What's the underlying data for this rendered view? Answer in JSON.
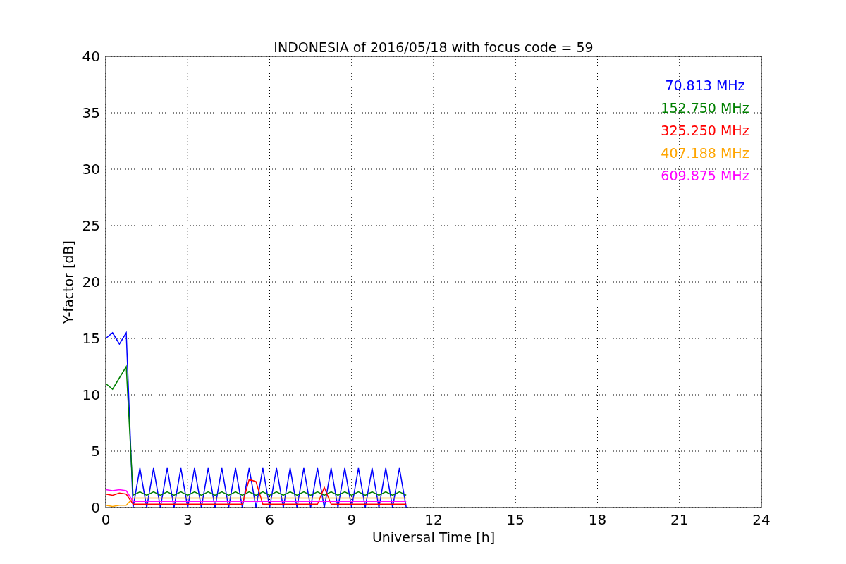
{
  "chart_data": {
    "type": "line",
    "title": "INDONESIA of 2016/05/18 with focus code = 59",
    "xlabel": "Universal Time [h]",
    "ylabel": "Y-factor [dB]",
    "x": [
      0,
      0.25,
      0.5,
      0.75,
      1,
      1.25,
      1.5,
      1.75,
      2,
      2.25,
      2.5,
      2.75,
      3,
      3.25,
      3.5,
      3.75,
      4,
      4.25,
      4.5,
      4.75,
      5,
      5.25,
      5.5,
      5.75,
      6,
      6.25,
      6.5,
      6.75,
      7,
      7.25,
      7.5,
      7.75,
      8,
      8.25,
      8.5,
      8.75,
      9,
      9.25,
      9.5,
      9.75,
      10,
      10.25,
      10.5,
      10.75,
      11
    ],
    "series": [
      {
        "name": "70.813 MHz",
        "color": "#0000ff",
        "values": [
          15,
          15.5,
          14.5,
          15.5,
          0,
          3.5,
          0,
          3.5,
          0,
          3.5,
          0,
          3.5,
          0,
          3.5,
          0,
          3.5,
          0,
          3.5,
          0,
          3.5,
          0,
          3.5,
          0,
          3.5,
          0,
          3.5,
          0,
          3.5,
          0,
          3.5,
          0,
          3.5,
          0,
          3.5,
          0,
          3.5,
          0,
          3.5,
          0,
          3.5,
          0,
          3.5,
          0,
          3.5,
          0
        ]
      },
      {
        "name": "152.750 MHz",
        "color": "#008000",
        "values": [
          11,
          10.5,
          11.5,
          12.5,
          1.1,
          1.4,
          1.1,
          1.4,
          1.1,
          1.4,
          1.1,
          1.4,
          1.1,
          1.4,
          1.1,
          1.4,
          1.1,
          1.4,
          1.1,
          1.4,
          1.1,
          1.4,
          1.1,
          1.4,
          1.1,
          1.4,
          1.1,
          1.4,
          1.1,
          1.4,
          1.1,
          1.4,
          1.1,
          1.4,
          1.1,
          1.4,
          1.1,
          1.4,
          1.1,
          1.4,
          1.1,
          1.4,
          1.1,
          1.4,
          1.1
        ]
      },
      {
        "name": "325.250 MHz",
        "color": "#ff0000",
        "values": [
          1.2,
          1.1,
          1.3,
          1.2,
          0.3,
          0.3,
          0.3,
          0.3,
          0.3,
          0.3,
          0.3,
          0.3,
          0.3,
          0.3,
          0.3,
          0.3,
          0.3,
          0.3,
          0.3,
          0.3,
          0.3,
          2.5,
          2.3,
          0.3,
          0.3,
          0.3,
          0.3,
          0.3,
          0.3,
          0.3,
          0.3,
          0.3,
          1.8,
          0.3,
          0.3,
          0.3,
          0.3,
          0.3,
          0.3,
          0.3,
          0.3,
          0.3,
          0.3,
          0.3,
          0.3
        ]
      },
      {
        "name": "407.188 MHz",
        "color": "#ffa500",
        "values": [
          0.2,
          0.1,
          0.2,
          0.2,
          0.85,
          0.85,
          0.85,
          0.85,
          0.85,
          0.85,
          0.85,
          0.85,
          0.85,
          0.85,
          0.85,
          0.85,
          0.85,
          0.85,
          0.85,
          0.85,
          0.85,
          0.85,
          0.85,
          0.85,
          0.85,
          0.85,
          0.85,
          0.85,
          0.85,
          0.85,
          0.85,
          0.85,
          0.85,
          0.85,
          0.85,
          0.85,
          0.85,
          0.85,
          0.85,
          0.85,
          0.85,
          0.85,
          0.85,
          0.85,
          0.85
        ]
      },
      {
        "name": "609.875 MHz",
        "color": "#ff00ff",
        "values": [
          1.6,
          1.5,
          1.6,
          1.5,
          0.55,
          0.55,
          0.55,
          0.55,
          0.55,
          0.55,
          0.55,
          0.55,
          0.55,
          0.55,
          0.55,
          0.55,
          0.55,
          0.55,
          0.55,
          0.55,
          0.55,
          0.55,
          0.55,
          0.55,
          0.55,
          0.55,
          0.55,
          0.55,
          0.55,
          0.55,
          0.55,
          0.55,
          0.55,
          0.55,
          0.55,
          0.55,
          0.55,
          0.55,
          0.55,
          0.55,
          0.55,
          0.55,
          0.55,
          0.55,
          0.55
        ]
      }
    ],
    "xlim": [
      0,
      24
    ],
    "ylim": [
      0,
      40
    ],
    "xticks": [
      0,
      3,
      6,
      9,
      12,
      15,
      18,
      21,
      24
    ],
    "yticks": [
      0,
      5,
      10,
      15,
      20,
      25,
      30,
      35,
      40
    ],
    "grid": true
  }
}
